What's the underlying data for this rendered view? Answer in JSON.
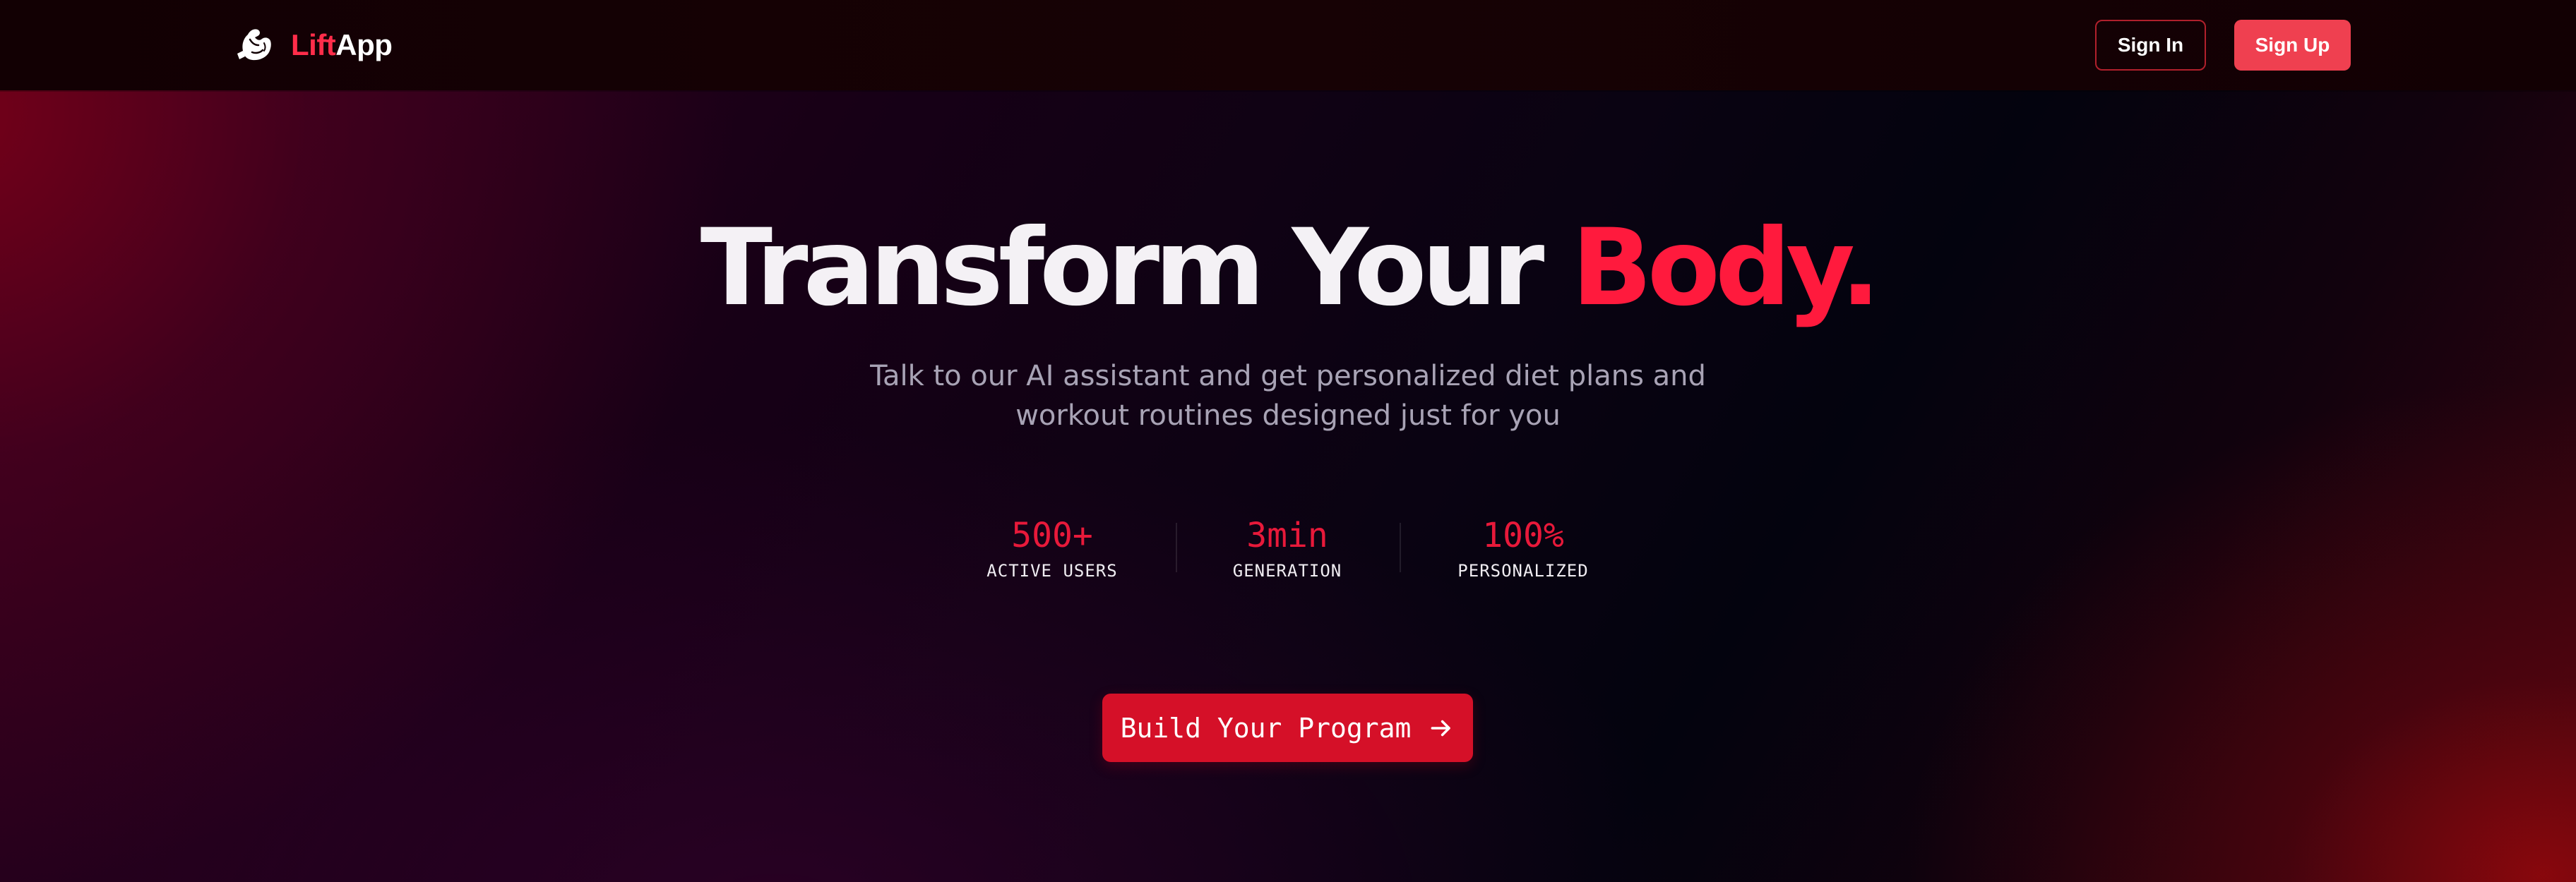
{
  "brand": {
    "name_part_1": "Lift",
    "name_part_2": "App",
    "logo_icon": "flexing-arm-icon",
    "accent_color": "#ff2d4a"
  },
  "nav": {
    "sign_in_label": "Sign In",
    "sign_up_label": "Sign Up"
  },
  "hero": {
    "title_main": "Transform Your ",
    "title_accent": "Body.",
    "subtitle": "Talk to our AI assistant and get personalized diet plans and workout routines designed just for you",
    "accent_color": "#ff1a3d"
  },
  "stats": [
    {
      "value": "500+",
      "label": "ACTIVE USERS"
    },
    {
      "value": "3min",
      "label": "GENERATION"
    },
    {
      "value": "100%",
      "label": "PERSONALIZED"
    }
  ],
  "cta": {
    "label": "Build Your Program",
    "icon": "arrow-right-icon",
    "color": "#d51028"
  }
}
